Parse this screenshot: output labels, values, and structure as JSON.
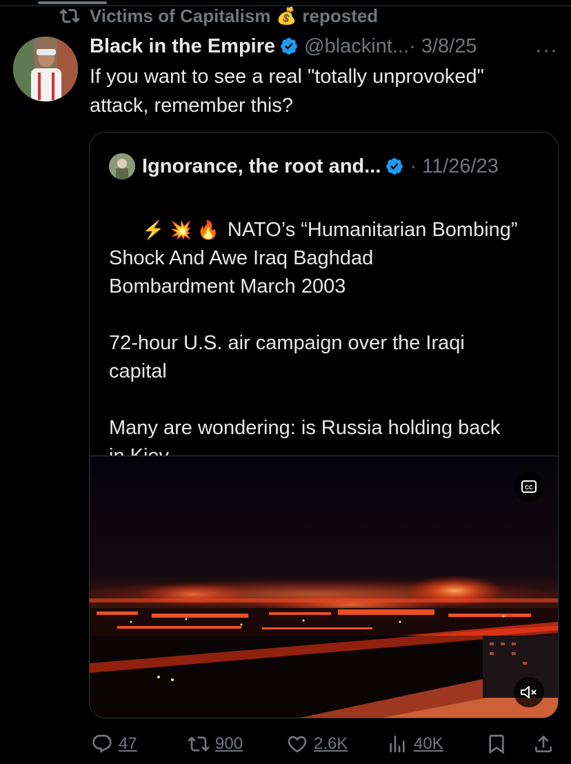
{
  "repost": {
    "user": "Victims of Capitalism",
    "emoji": "💰",
    "label": "reposted"
  },
  "tweet": {
    "name": "Black in the Empire",
    "handle": "@blackint...",
    "date": "· 3/8/25",
    "more": "···",
    "text": "If you want to see a real \"totally unprovoked\"\nattack, remember this?"
  },
  "quote": {
    "name": "Ignorance, the root and...",
    "date": "· 11/26/23",
    "emojis": "⚡ 💥 🔥",
    "text": "NATO’s “Humanitarian Bombing”\nShock And Awe Iraq Baghdad\nBombardment March 2003\n\n72-hour U.S. air campaign over the Iraqi\ncapital\n\nMany are wondering: is Russia holding back\nin Kiev ...",
    "video": {
      "cc_icon": "closed-captions-icon",
      "mute_icon": "muted-speaker-icon"
    }
  },
  "actions": {
    "replies": "47",
    "reposts": "900",
    "likes": "2.6K",
    "views": "40K"
  },
  "colors": {
    "background": "#000000",
    "text": "#e7e9ea",
    "muted": "#71767b",
    "verified": "#1d9bf0",
    "border": "#2f3336"
  }
}
